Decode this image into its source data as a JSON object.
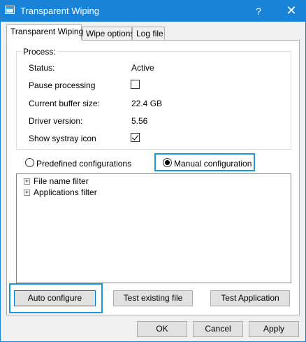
{
  "window": {
    "title": "Transparent Wiping",
    "help": "?",
    "close": "✕"
  },
  "tabs": [
    {
      "label": "Transparent Wiping",
      "active": true
    },
    {
      "label": "Wipe options",
      "active": false
    },
    {
      "label": "Log file",
      "active": false
    }
  ],
  "process": {
    "group_label": "Process:",
    "status_label": "Status:",
    "status_value": "Active",
    "pause_label": "Pause processing",
    "pause_checked": false,
    "buffer_label": "Current buffer size:",
    "buffer_value": "22.4 GB",
    "driver_label": "Driver version:",
    "driver_value": "5.56",
    "systray_label": "Show systray icon",
    "systray_checked": true
  },
  "config": {
    "predefined_label": "Predefined configurations",
    "manual_label": "Manual configuration",
    "selected": "manual"
  },
  "tree": [
    {
      "label": "File name filter",
      "expander": "+"
    },
    {
      "label": "Applications filter",
      "expander": "+"
    }
  ],
  "actions": {
    "auto_configure": "Auto configure",
    "test_file": "Test existing file",
    "test_app": "Test Application"
  },
  "footer": {
    "ok": "OK",
    "cancel": "Cancel",
    "apply": "Apply"
  },
  "colors": {
    "titlebar": "#1883d7",
    "highlight": "#1a9ad6"
  }
}
